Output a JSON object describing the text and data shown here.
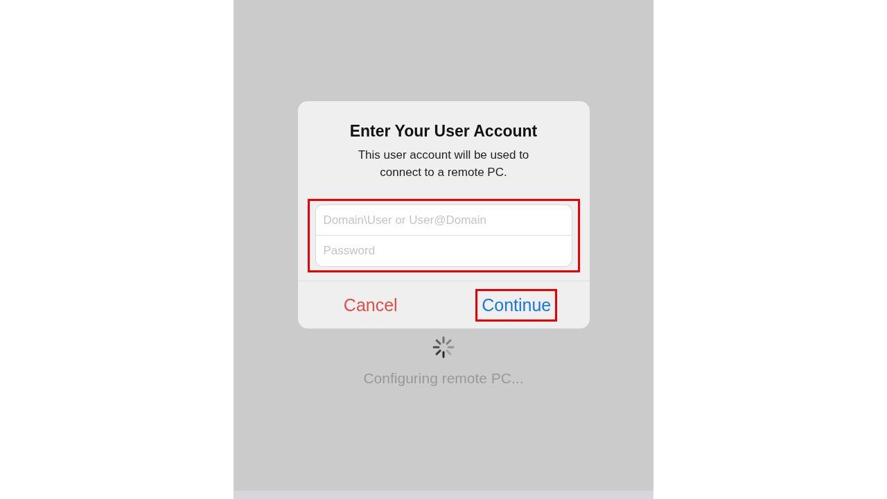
{
  "dialog": {
    "title": "Enter Your User Account",
    "message": "This user account will be used to connect to a remote PC.",
    "fields_highlighted": true,
    "fields": [
      {
        "placeholder": "Domain\\User or User@Domain"
      },
      {
        "placeholder": "Password"
      }
    ],
    "buttons": [
      {
        "kind": "cancel",
        "label": "Cancel",
        "highlighted": false
      },
      {
        "kind": "confirm",
        "label": "Continue",
        "highlighted": true
      }
    ]
  },
  "status": {
    "text": "Configuring remote PC..."
  }
}
